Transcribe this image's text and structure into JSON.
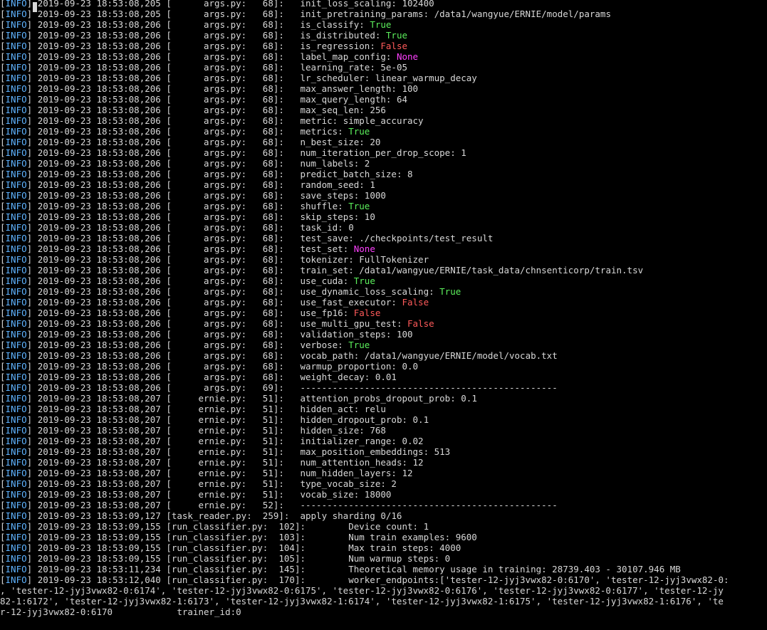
{
  "terminal": {
    "lines": [
      {
        "level": "INFO",
        "ts": "2019-09-23 18:53:08,205",
        "src": "[      args.py:   68]:",
        "msg": "   init_loss_scaling: ",
        "val": "102400",
        "vt": ""
      },
      {
        "level": "INFO",
        "ts": "2019-09-23 18:53:08,205",
        "src": "[      args.py:   68]:",
        "msg": "   init_pretraining_params: ",
        "val": "/data1/wangyue/ERNIE/model/params",
        "vt": ""
      },
      {
        "level": "INFO",
        "ts": "2019-09-23 18:53:08,206",
        "src": "[      args.py:   68]:",
        "msg": "   is_classify: ",
        "val": "True",
        "vt": "true"
      },
      {
        "level": "INFO",
        "ts": "2019-09-23 18:53:08,206",
        "src": "[      args.py:   68]:",
        "msg": "   is_distributed: ",
        "val": "True",
        "vt": "true"
      },
      {
        "level": "INFO",
        "ts": "2019-09-23 18:53:08,206",
        "src": "[      args.py:   68]:",
        "msg": "   is_regression: ",
        "val": "False",
        "vt": "false"
      },
      {
        "level": "INFO",
        "ts": "2019-09-23 18:53:08,206",
        "src": "[      args.py:   68]:",
        "msg": "   label_map_config: ",
        "val": "None",
        "vt": "none"
      },
      {
        "level": "INFO",
        "ts": "2019-09-23 18:53:08,206",
        "src": "[      args.py:   68]:",
        "msg": "   learning_rate: ",
        "val": "5e-05",
        "vt": ""
      },
      {
        "level": "INFO",
        "ts": "2019-09-23 18:53:08,206",
        "src": "[      args.py:   68]:",
        "msg": "   lr_scheduler: ",
        "val": "linear_warmup_decay",
        "vt": ""
      },
      {
        "level": "INFO",
        "ts": "2019-09-23 18:53:08,206",
        "src": "[      args.py:   68]:",
        "msg": "   max_answer_length: ",
        "val": "100",
        "vt": ""
      },
      {
        "level": "INFO",
        "ts": "2019-09-23 18:53:08,206",
        "src": "[      args.py:   68]:",
        "msg": "   max_query_length: ",
        "val": "64",
        "vt": ""
      },
      {
        "level": "INFO",
        "ts": "2019-09-23 18:53:08,206",
        "src": "[      args.py:   68]:",
        "msg": "   max_seq_len: ",
        "val": "256",
        "vt": ""
      },
      {
        "level": "INFO",
        "ts": "2019-09-23 18:53:08,206",
        "src": "[      args.py:   68]:",
        "msg": "   metric: ",
        "val": "simple_accuracy",
        "vt": ""
      },
      {
        "level": "INFO",
        "ts": "2019-09-23 18:53:08,206",
        "src": "[      args.py:   68]:",
        "msg": "   metrics: ",
        "val": "True",
        "vt": "true"
      },
      {
        "level": "INFO",
        "ts": "2019-09-23 18:53:08,206",
        "src": "[      args.py:   68]:",
        "msg": "   n_best_size: ",
        "val": "20",
        "vt": ""
      },
      {
        "level": "INFO",
        "ts": "2019-09-23 18:53:08,206",
        "src": "[      args.py:   68]:",
        "msg": "   num_iteration_per_drop_scope: ",
        "val": "1",
        "vt": ""
      },
      {
        "level": "INFO",
        "ts": "2019-09-23 18:53:08,206",
        "src": "[      args.py:   68]:",
        "msg": "   num_labels: ",
        "val": "2",
        "vt": ""
      },
      {
        "level": "INFO",
        "ts": "2019-09-23 18:53:08,206",
        "src": "[      args.py:   68]:",
        "msg": "   predict_batch_size: ",
        "val": "8",
        "vt": ""
      },
      {
        "level": "INFO",
        "ts": "2019-09-23 18:53:08,206",
        "src": "[      args.py:   68]:",
        "msg": "   random_seed: ",
        "val": "1",
        "vt": ""
      },
      {
        "level": "INFO",
        "ts": "2019-09-23 18:53:08,206",
        "src": "[      args.py:   68]:",
        "msg": "   save_steps: ",
        "val": "1000",
        "vt": ""
      },
      {
        "level": "INFO",
        "ts": "2019-09-23 18:53:08,206",
        "src": "[      args.py:   68]:",
        "msg": "   shuffle: ",
        "val": "True",
        "vt": "true"
      },
      {
        "level": "INFO",
        "ts": "2019-09-23 18:53:08,206",
        "src": "[      args.py:   68]:",
        "msg": "   skip_steps: ",
        "val": "10",
        "vt": ""
      },
      {
        "level": "INFO",
        "ts": "2019-09-23 18:53:08,206",
        "src": "[      args.py:   68]:",
        "msg": "   task_id: ",
        "val": "0",
        "vt": ""
      },
      {
        "level": "INFO",
        "ts": "2019-09-23 18:53:08,206",
        "src": "[      args.py:   68]:",
        "msg": "   test_save: ",
        "val": "./checkpoints/test_result",
        "vt": ""
      },
      {
        "level": "INFO",
        "ts": "2019-09-23 18:53:08,206",
        "src": "[      args.py:   68]:",
        "msg": "   test_set: ",
        "val": "None",
        "vt": "none"
      },
      {
        "level": "INFO",
        "ts": "2019-09-23 18:53:08,206",
        "src": "[      args.py:   68]:",
        "msg": "   tokenizer: ",
        "val": "FullTokenizer",
        "vt": ""
      },
      {
        "level": "INFO",
        "ts": "2019-09-23 18:53:08,206",
        "src": "[      args.py:   68]:",
        "msg": "   train_set: ",
        "val": "/data1/wangyue/ERNIE/task_data/chnsenticorp/train.tsv",
        "vt": ""
      },
      {
        "level": "INFO",
        "ts": "2019-09-23 18:53:08,206",
        "src": "[      args.py:   68]:",
        "msg": "   use_cuda: ",
        "val": "True",
        "vt": "true"
      },
      {
        "level": "INFO",
        "ts": "2019-09-23 18:53:08,206",
        "src": "[      args.py:   68]:",
        "msg": "   use_dynamic_loss_scaling: ",
        "val": "True",
        "vt": "true"
      },
      {
        "level": "INFO",
        "ts": "2019-09-23 18:53:08,206",
        "src": "[      args.py:   68]:",
        "msg": "   use_fast_executor: ",
        "val": "False",
        "vt": "false"
      },
      {
        "level": "INFO",
        "ts": "2019-09-23 18:53:08,206",
        "src": "[      args.py:   68]:",
        "msg": "   use_fp16: ",
        "val": "False",
        "vt": "false"
      },
      {
        "level": "INFO",
        "ts": "2019-09-23 18:53:08,206",
        "src": "[      args.py:   68]:",
        "msg": "   use_multi_gpu_test: ",
        "val": "False",
        "vt": "false"
      },
      {
        "level": "INFO",
        "ts": "2019-09-23 18:53:08,206",
        "src": "[      args.py:   68]:",
        "msg": "   validation_steps: ",
        "val": "100",
        "vt": ""
      },
      {
        "level": "INFO",
        "ts": "2019-09-23 18:53:08,206",
        "src": "[      args.py:   68]:",
        "msg": "   verbose: ",
        "val": "True",
        "vt": "true"
      },
      {
        "level": "INFO",
        "ts": "2019-09-23 18:53:08,206",
        "src": "[      args.py:   68]:",
        "msg": "   vocab_path: ",
        "val": "/data1/wangyue/ERNIE/model/vocab.txt",
        "vt": ""
      },
      {
        "level": "INFO",
        "ts": "2019-09-23 18:53:08,206",
        "src": "[      args.py:   68]:",
        "msg": "   warmup_proportion: ",
        "val": "0.0",
        "vt": ""
      },
      {
        "level": "INFO",
        "ts": "2019-09-23 18:53:08,206",
        "src": "[      args.py:   68]:",
        "msg": "   weight_decay: ",
        "val": "0.01",
        "vt": ""
      },
      {
        "level": "INFO",
        "ts": "2019-09-23 18:53:08,206",
        "src": "[      args.py:   69]:",
        "msg": "   ------------------------------------------------",
        "val": "",
        "vt": ""
      },
      {
        "level": "INFO",
        "ts": "2019-09-23 18:53:08,207",
        "src": "[     ernie.py:   51]:",
        "msg": "   attention_probs_dropout_prob: ",
        "val": "0.1",
        "vt": ""
      },
      {
        "level": "INFO",
        "ts": "2019-09-23 18:53:08,207",
        "src": "[     ernie.py:   51]:",
        "msg": "   hidden_act: ",
        "val": "relu",
        "vt": ""
      },
      {
        "level": "INFO",
        "ts": "2019-09-23 18:53:08,207",
        "src": "[     ernie.py:   51]:",
        "msg": "   hidden_dropout_prob: ",
        "val": "0.1",
        "vt": ""
      },
      {
        "level": "INFO",
        "ts": "2019-09-23 18:53:08,207",
        "src": "[     ernie.py:   51]:",
        "msg": "   hidden_size: ",
        "val": "768",
        "vt": ""
      },
      {
        "level": "INFO",
        "ts": "2019-09-23 18:53:08,207",
        "src": "[     ernie.py:   51]:",
        "msg": "   initializer_range: ",
        "val": "0.02",
        "vt": ""
      },
      {
        "level": "INFO",
        "ts": "2019-09-23 18:53:08,207",
        "src": "[     ernie.py:   51]:",
        "msg": "   max_position_embeddings: ",
        "val": "513",
        "vt": ""
      },
      {
        "level": "INFO",
        "ts": "2019-09-23 18:53:08,207",
        "src": "[     ernie.py:   51]:",
        "msg": "   num_attention_heads: ",
        "val": "12",
        "vt": ""
      },
      {
        "level": "INFO",
        "ts": "2019-09-23 18:53:08,207",
        "src": "[     ernie.py:   51]:",
        "msg": "   num_hidden_layers: ",
        "val": "12",
        "vt": ""
      },
      {
        "level": "INFO",
        "ts": "2019-09-23 18:53:08,207",
        "src": "[     ernie.py:   51]:",
        "msg": "   type_vocab_size: ",
        "val": "2",
        "vt": ""
      },
      {
        "level": "INFO",
        "ts": "2019-09-23 18:53:08,207",
        "src": "[     ernie.py:   51]:",
        "msg": "   vocab_size: ",
        "val": "18000",
        "vt": ""
      },
      {
        "level": "INFO",
        "ts": "2019-09-23 18:53:08,207",
        "src": "[     ernie.py:   52]:",
        "msg": "   ------------------------------------------------",
        "val": "",
        "vt": ""
      },
      {
        "level": "INFO",
        "ts": "2019-09-23 18:53:09,127",
        "src": "[task_reader.py:  259]:",
        "msg": "  apply sharding 0/16",
        "val": "",
        "vt": ""
      },
      {
        "level": "INFO",
        "ts": "2019-09-23 18:53:09,155",
        "src": "[run_classifier.py:  102]:",
        "msg": "        Device count: 1",
        "val": "",
        "vt": ""
      },
      {
        "level": "INFO",
        "ts": "2019-09-23 18:53:09,155",
        "src": "[run_classifier.py:  103]:",
        "msg": "        Num train examples: 9600",
        "val": "",
        "vt": ""
      },
      {
        "level": "INFO",
        "ts": "2019-09-23 18:53:09,155",
        "src": "[run_classifier.py:  104]:",
        "msg": "        Max train steps: 4000",
        "val": "",
        "vt": ""
      },
      {
        "level": "INFO",
        "ts": "2019-09-23 18:53:09,155",
        "src": "[run_classifier.py:  105]:",
        "msg": "        Num warmup steps: 0",
        "val": "",
        "vt": ""
      },
      {
        "level": "INFO",
        "ts": "2019-09-23 18:53:11,234",
        "src": "[run_classifier.py:  145]:",
        "msg": "        Theoretical memory usage in training: 28739.403 - 30107.946 MB",
        "val": "",
        "vt": ""
      },
      {
        "level": "INFO",
        "ts": "2019-09-23 18:53:12,040",
        "src": "[run_classifier.py:  170]:",
        "msg": "        worker_endpoints:['tester-12-jyj3vwx82-0:6170', 'tester-12-jyj3vwx82-0:",
        "val": "",
        "vt": ""
      }
    ],
    "wrap_lines": [
      ", 'tester-12-jyj3vwx82-0:6174', 'tester-12-jyj3vwx82-0:6175', 'tester-12-jyj3vwx82-0:6176', 'tester-12-jyj3vwx82-0:6177', 'tester-12-jy",
      "82-1:6172', 'tester-12-jyj3vwx82-1:6173', 'tester-12-jyj3vwx82-1:6174', 'tester-12-jyj3vwx82-1:6175', 'tester-12-jyj3vwx82-1:6176', 'te",
      "r-12-jyj3vwx82-0:6170            trainer_id:0"
    ]
  }
}
